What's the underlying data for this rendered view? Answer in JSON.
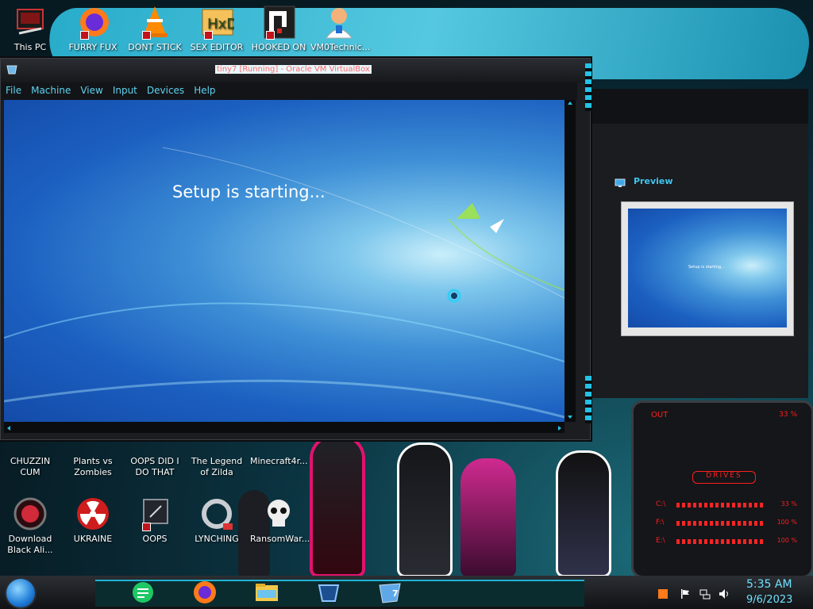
{
  "desktop": {
    "top_icons": [
      {
        "label": "This PC",
        "icon": "this-pc-icon"
      },
      {
        "label": "FURRY FUX",
        "icon": "firefox-icon"
      },
      {
        "label": "DONT STICK",
        "icon": "vlc-icon"
      },
      {
        "label": "SEX EDITOR",
        "icon": "hxd-icon"
      },
      {
        "label": "HOOKED ON",
        "icon": "app-icon"
      },
      {
        "label": "VM0Technic...",
        "icon": "doctor-icon"
      }
    ],
    "mid_icons": [
      {
        "label": "CHUZZIN CUM",
        "icon": "game-icon"
      },
      {
        "label": "Plants vs Zombies",
        "icon": "plant-icon"
      },
      {
        "label": "OOPS DID I DO THAT",
        "icon": "app-icon"
      },
      {
        "label": "The Legend of Zilda",
        "icon": "game-icon"
      },
      {
        "label": "Minecraft4r...",
        "icon": "minecraft-icon"
      }
    ],
    "bottom_icons": [
      {
        "label": "Download Black Ali...",
        "icon": "red-orb-icon"
      },
      {
        "label": "UKRAINE",
        "icon": "radiation-icon"
      },
      {
        "label": "OOPS",
        "icon": "monitor-icon"
      },
      {
        "label": "LYNCHING",
        "icon": "noose-icon"
      },
      {
        "label": "RansomWar...",
        "icon": "skull-icon"
      }
    ]
  },
  "vbox": {
    "title": "tiny7 [Running] - Oracle VM VirtualBox",
    "menu": [
      "File",
      "Machine",
      "View",
      "Input",
      "Devices",
      "Help"
    ],
    "setup_text": "Setup is starting...",
    "preview_title": "Preview",
    "preview_text": "Setup is starting..."
  },
  "widget": {
    "out_label": "OUT",
    "out_value": "33 %",
    "drives_label": "DRIVES",
    "drives": [
      {
        "label": "C:\\",
        "value": "33 %"
      },
      {
        "label": "F:\\",
        "value": "100 %"
      },
      {
        "label": "E:\\",
        "value": "100 %"
      }
    ]
  },
  "taskbar": {
    "time": "5:35 AM",
    "date": "9/6/2023",
    "buttons": [
      "notes-icon",
      "firefox-icon",
      "folder-icon",
      "virtualbox-icon",
      "windows7-icon"
    ],
    "windows7_badge": "7"
  },
  "colors": {
    "accent": "#22c3e6",
    "widget_red": "#ff1e1e"
  }
}
